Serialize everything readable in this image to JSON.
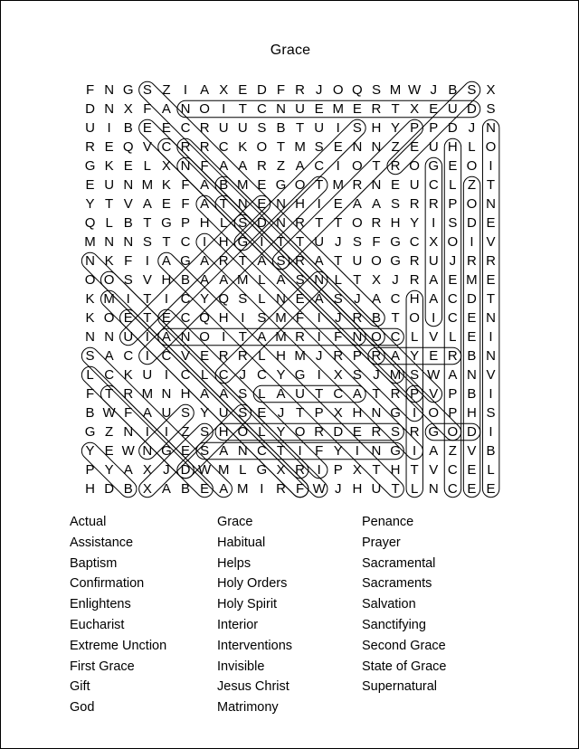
{
  "title": "Grace",
  "grid": {
    "rows": 22,
    "cols": 22,
    "letters": [
      "F N G S Z I A X E D F R J O Q S M W J B S X",
      "D N X F A N O I T C N U E M E R T X E U D S",
      "U I B E E C R U U S B T U I S H Y P P D J N",
      "R E Q V C R R C K O T M S E N N Z E U H L O",
      "G K E L X N F A A R Z A C I O T R O G E O I",
      "E U N M K F A B M E G O T M R N E U C L Z T",
      "Y T V A E F A T N E N H I E A A S R R P O N",
      "Q L B T G P H L S D N R T T O R H Y I S D E",
      "M N N S T C I H G I T T U J S F G C X O I V",
      "N K F I A G A R T A S R A T U O G R U J R R",
      "O O S V H B A A M L A S N L T X J R A E M E",
      "K M I T I C Y Q S L N E A S J A C H A C D T",
      "K O E T E C Q H I S M F I J R B T O I C E N",
      "N N U I A N O I T A M R I F N O C L V L E I",
      "S A C I C V E R R L H M J R P R A Y E R B N",
      "L C K U I C L C J C Y G I X S J M S W A N V",
      "F T R M N H A A S L A U T C A T R P V P B I",
      "B W F A U S Y U S E J T P X H N G I O P H S",
      "G Z N I I Z S H O L Y O R D E R S R G O D I",
      "Y E W N G E S A N C T I F Y I N G I A Z V B",
      "P Y A X J D W M L G X R I P X T H T V C E L",
      "H D B X A B E A M I R F W J H U T L N C E E"
    ]
  },
  "wordlist": {
    "columns": [
      [
        "Actual",
        "Assistance",
        "Baptism",
        "Confirmation",
        "Enlightens",
        "Eucharist",
        "Extreme Unction",
        "First Grace",
        "Gift",
        "God"
      ],
      [
        "Grace",
        "Habitual",
        "Helps",
        "Holy Orders",
        "Holy Spirit",
        "Interior",
        "Interventions",
        "Invisible",
        "Jesus Christ",
        "Matrimony"
      ],
      [
        "Penance",
        "Prayer",
        "Sacramental",
        "Sacraments",
        "Salvation",
        "Sanctifying",
        "Second Grace",
        "State of Grace",
        "Supernatural"
      ]
    ]
  },
  "colors": {
    "ink": "#000000",
    "paper": "#ffffff"
  }
}
